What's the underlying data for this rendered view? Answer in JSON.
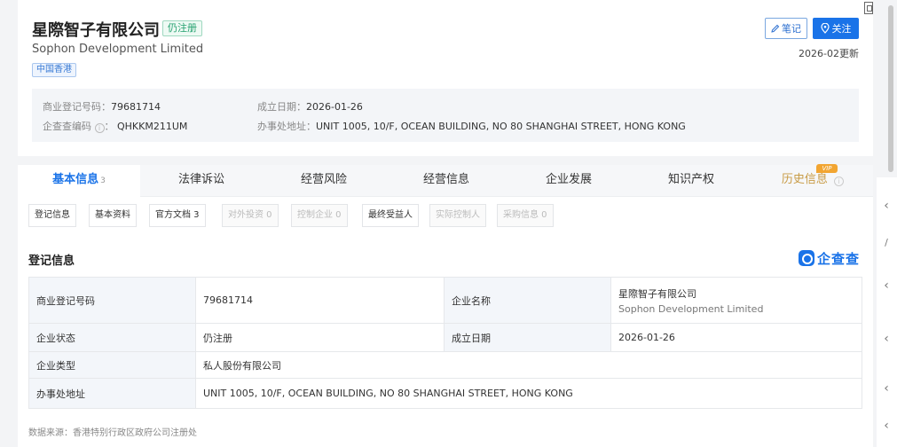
{
  "header": {
    "company_name": "星際智子有限公司",
    "status": "仍注册",
    "english_name": "Sophon Development Limited",
    "region": "中国香港",
    "note_label": "笔记",
    "follow_label": "关注",
    "updated": "2026-02更新"
  },
  "summary": {
    "reg_no_label": "商业登记号码：",
    "reg_no": "79681714",
    "founded_label": "成立日期：",
    "founded": "2026-01-26",
    "qcc_label": "企查查编码",
    "qcc_code": "QHKKM211UM",
    "address_label": "办事处地址：",
    "address": "UNIT 1005, 10/F, OCEAN BUILDING, NO 80 SHANGHAI STREET, HONG KONG"
  },
  "tabs": [
    {
      "label": "基本信息",
      "count": "3"
    },
    {
      "label": "法律诉讼"
    },
    {
      "label": "经营风险"
    },
    {
      "label": "经营信息"
    },
    {
      "label": "企业发展"
    },
    {
      "label": "知识产权"
    },
    {
      "label": "历史信息",
      "badge": "VIP"
    }
  ],
  "subtabs": [
    {
      "label": "登记信息"
    },
    {
      "label": "基本资料"
    },
    {
      "label": "官方文档 3"
    },
    {
      "label": "对外投资 0"
    },
    {
      "label": "控制企业 0"
    },
    {
      "label": "最终受益人"
    },
    {
      "label": "实际控制人"
    },
    {
      "label": "采购信息 0"
    }
  ],
  "section": {
    "title": "登记信息",
    "brand": "企查查"
  },
  "table": {
    "reg_no_key": "商业登记号码",
    "reg_no_val": "79681714",
    "name_key": "企业名称",
    "name_val": "星際智子有限公司",
    "name_val_en": "Sophon Development Limited",
    "status_key": "企业状态",
    "status_val": "仍注册",
    "founded_key": "成立日期",
    "founded_val": "2026-01-26",
    "type_key": "企业类型",
    "type_val": "私人股份有限公司",
    "address_key": "办事处地址",
    "address_val": "UNIT 1005, 10/F, OCEAN BUILDING, NO 80 SHANGHAI STREET, HONG KONG"
  },
  "footer": {
    "source": "数据来源：香港特别行政区政府公司注册处"
  }
}
